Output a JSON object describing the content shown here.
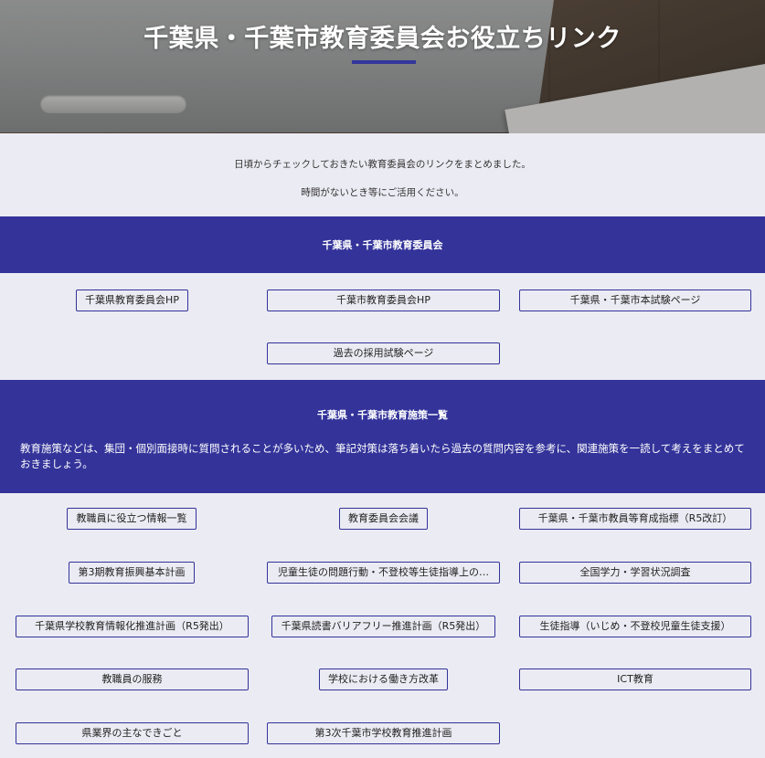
{
  "hero": {
    "title": "千葉県・千葉市教育委員会お役立ちリンク"
  },
  "intro": {
    "line1": "日頃からチェックしておきたい教育委員会のリンクをまとめました。",
    "line2": "時間がないとき等にご活用ください。"
  },
  "section1": {
    "title": "千葉県・千葉市教育委員会",
    "links": [
      "千葉県教育委員会HP",
      "千葉市教育委員会HP",
      "千葉県・千葉市本試験ページ",
      "過去の採用試験ページ"
    ]
  },
  "section2": {
    "title": "千葉県・千葉市教育施策一覧",
    "description": "教育施策などは、集団・個別面接時に質問されることが多いため、筆記対策は落ち着いたら過去の質問内容を参考に、関連施策を一読して考えをまとめておきましょう。",
    "links": [
      "教職員に役立つ情報一覧",
      "教育委員会会議",
      "千葉県・千葉市教員等育成指標（R5改訂）",
      "第3期教育振興基本計画",
      "児童生徒の問題行動・不登校等生徒指導上の…",
      "全国学力・学習状況調査",
      "千葉県学校教育情報化推進計画（R5発出）",
      "千葉県読書バリアフリー推進計画（R5発出）",
      "生徒指導（いじめ・不登校児童生徒支援）",
      "教職員の服務",
      "学校における働き方改革",
      "ICT教育",
      "県業界の主なできごと",
      "第3次千葉市学校教育推進計画"
    ]
  }
}
